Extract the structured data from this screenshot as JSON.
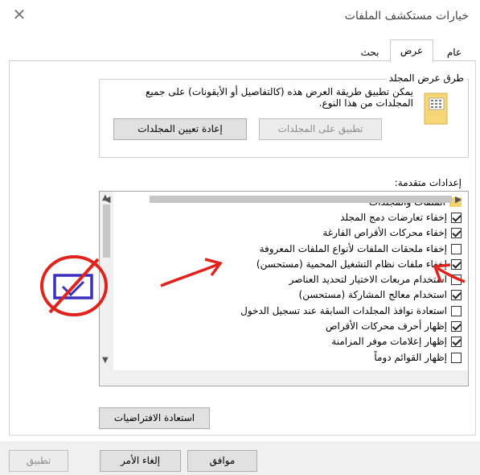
{
  "window": {
    "title": "خيارات مستكشف الملفات",
    "close_icon": "close-icon"
  },
  "tabs": [
    {
      "label": "عام",
      "active": false
    },
    {
      "label": "عرض",
      "active": true
    },
    {
      "label": "بحث",
      "active": false
    }
  ],
  "folder_views": {
    "legend": "طرق عرض المجلد",
    "description": "يمكن تطبيق طريقة العرض هذه (كالتفاصيل أو الأيقونات) على جميع المجلدات من هذا النوع.",
    "apply_label": "تطبيق على المجلدات",
    "reset_label": "إعادة تعيين المجلدات",
    "icon": "folder-grid-icon"
  },
  "advanced": {
    "label": "إعدادات متقدمة:",
    "group_label": "الملفات والمجلدات",
    "items": [
      {
        "label": "إخفاء تعارضات دمج المجلد",
        "checked": true
      },
      {
        "label": "إخفاء محركات الأقراص الفارغة",
        "checked": true
      },
      {
        "label": "إخفاء ملحقات الملفات لأنواع الملفات المعروفة",
        "checked": false
      },
      {
        "label": "إخفاء ملفات نظام التشغيل المحمية (مستحسن)",
        "checked": true
      },
      {
        "label": "استخدام مربعات الاختيار لتحديد العناصر",
        "checked": false
      },
      {
        "label": "استخدام معالج المشاركة (مستحسن)",
        "checked": true
      },
      {
        "label": "استعادة نوافذ المجلدات السابقة عند تسجيل الدخول",
        "checked": false
      },
      {
        "label": "إظهار أحرف محركات الأقراص",
        "checked": true
      },
      {
        "label": "إظهار إعلامات موفر المزامنة",
        "checked": true
      },
      {
        "label": "إظهار القوائم دوماً",
        "checked": false
      }
    ]
  },
  "restore_defaults_label": "استعادة الافتراضيات",
  "footer": {
    "ok_label": "موافق",
    "cancel_label": "إلغاء الأمر",
    "apply_label": "تطبيق"
  },
  "colors": {
    "annotation_red": "#e0231c",
    "annotation_blue": "#3b2fbf",
    "folder_yellow": "#f5d36b"
  }
}
